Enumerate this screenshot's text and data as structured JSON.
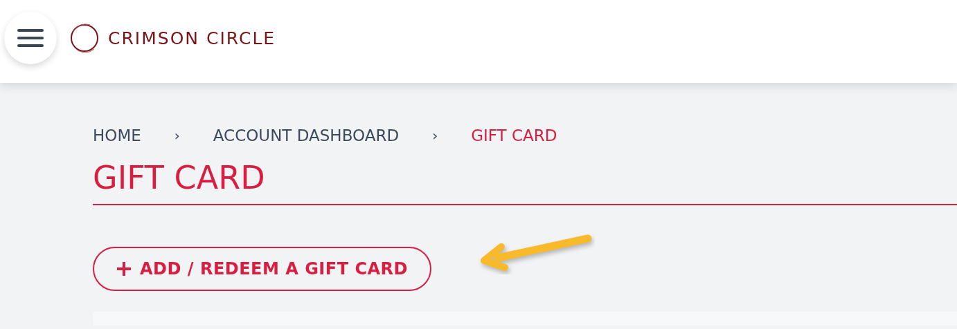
{
  "header": {
    "logo_text": "CRIMSON CIRCLE"
  },
  "breadcrumbs": [
    {
      "label": "HOME",
      "selected": false
    },
    {
      "label": "ACCOUNT DASHBOARD",
      "selected": false
    },
    {
      "label": "GIFT CARD",
      "selected": true
    }
  ],
  "breadcrumb_separator": "›",
  "page_title": "GIFT CARD",
  "add_button": {
    "label": "ADD / REDEEM A GIFT CARD"
  }
}
